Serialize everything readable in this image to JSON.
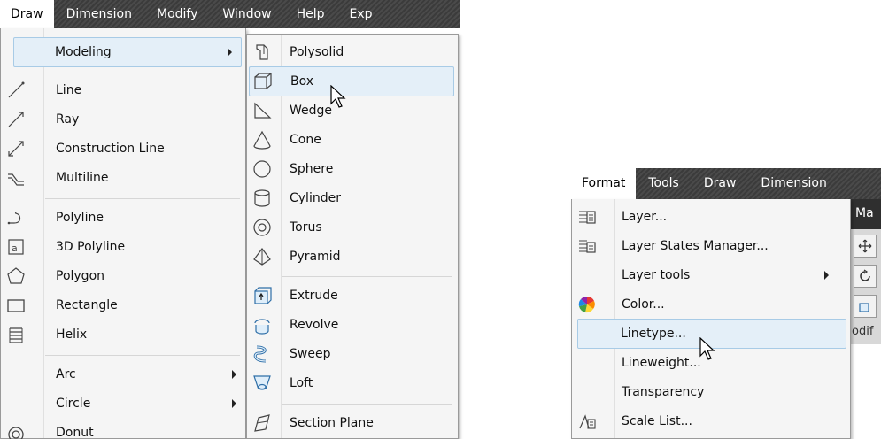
{
  "left_screen": {
    "menubar": [
      "Draw",
      "Dimension",
      "Modify",
      "Window",
      "Help",
      "Exp"
    ],
    "active_menu": "Draw",
    "draw_menu": {
      "modeling": "Modeling",
      "items": [
        "Line",
        "Ray",
        "Construction Line",
        "Multiline",
        "Polyline",
        "3D Polyline",
        "Polygon",
        "Rectangle",
        "Helix",
        "Arc",
        "Circle",
        "Donut"
      ]
    },
    "modeling_submenu": {
      "items": [
        "Polysolid",
        "Box",
        "Wedge",
        "Cone",
        "Sphere",
        "Cylinder",
        "Torus",
        "Pyramid",
        "Extrude",
        "Revolve",
        "Sweep",
        "Loft",
        "Section Plane"
      ],
      "highlighted": "Box"
    }
  },
  "right_screen": {
    "menubar": [
      "Format",
      "Tools",
      "Draw",
      "Dimension"
    ],
    "active_menu": "Format",
    "format_menu": {
      "items": [
        "Layer...",
        "Layer States Manager...",
        "Layer tools",
        "Color...",
        "Linetype...",
        "Lineweight...",
        "Transparency",
        "Scale List..."
      ],
      "highlighted": "Linetype..."
    },
    "background_text": [
      "Ma",
      "odif"
    ]
  },
  "colors": {
    "menubar_bg": "#434343",
    "menu_bg": "#f5f5f5",
    "highlight_bg": "#e4eff8",
    "highlight_border": "#a8cbe6"
  }
}
